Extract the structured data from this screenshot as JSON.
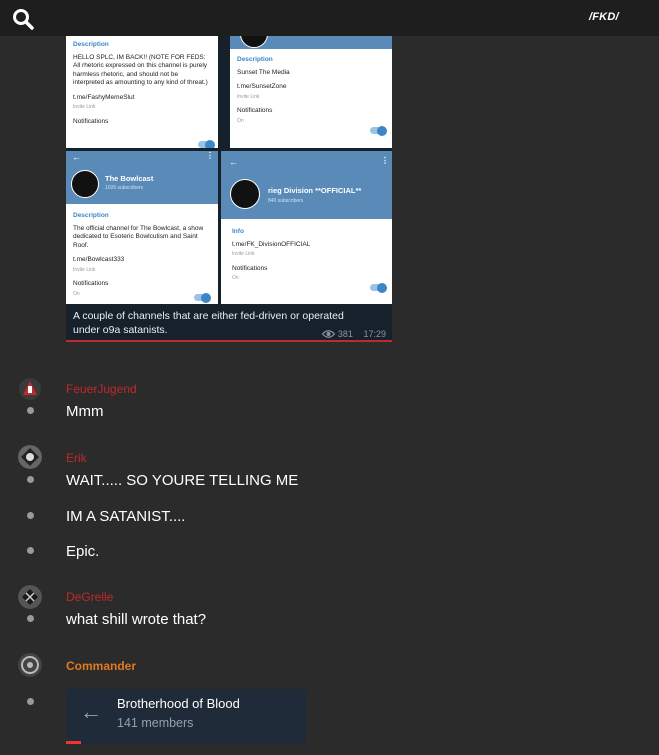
{
  "header": {
    "brand": "/FKD/",
    "search_icon": "search-icon"
  },
  "post": {
    "cards": {
      "top_left": {
        "section": "Description",
        "description": "HELLO SPLC, IM BACK!! (NOTE FOR FEDS: All rhetoric expressed on this channel is purely harmless rhetoric, and should not be interpreted as amounting to any kind of threat.)",
        "link": "t.me/FashyMemeSlut",
        "link_hint": "Invite Link",
        "notifications": "Notifications"
      },
      "top_right": {
        "section": "Description",
        "description": "Sunset The Media",
        "link": "t.me/SunsetZone",
        "link_hint": "Invite Link",
        "notifications": "Notifications",
        "notifications_state": "On"
      },
      "bottom_left": {
        "channel_name": "The Bowlcast",
        "subscribers": "1026 subscribers",
        "section": "Description",
        "description": "The official channel for The Bowlcast, a show dedicated to Esoteric Bowlcutism and Saint Roof.",
        "link": "t.me/Bowlcast333",
        "link_hint": "Invite Link",
        "notifications": "Notifications",
        "notifications_state": "On"
      },
      "bottom_right": {
        "channel_name": "rieg Division **OFFICIAL**",
        "subscribers": "840 subscribers",
        "section": "Info",
        "link": "t.me/FK_DivisionOFFICIAL",
        "link_hint": "Invite Link",
        "notifications": "Notifications",
        "notifications_state": "On"
      }
    },
    "caption": "A couple of channels that are either fed-driven or operated under o9a satanists.",
    "views": "381",
    "time": "17:29"
  },
  "messages": [
    {
      "author": "FeuerJugend",
      "author_color": "#c0282a",
      "lines": [
        "Mmm"
      ]
    },
    {
      "author": "Erik",
      "author_color": "#c0282a",
      "lines": [
        "WAIT..... SO YOURE TELLING ME",
        "IM A SATANIST....",
        "Epic."
      ]
    },
    {
      "author": "DeGrelle",
      "author_color": "#c0282a",
      "lines": [
        "what shill wrote that?"
      ]
    },
    {
      "author": "Commander",
      "author_color": "#e07a1f",
      "lines": []
    }
  ],
  "link_preview": {
    "title": "Brotherhood of Blood",
    "subtitle": "141 members"
  }
}
